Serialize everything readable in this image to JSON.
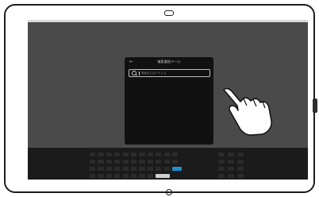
{
  "panel": {
    "back_icon": "←",
    "title": "検索要相ページ"
  },
  "search": {
    "icon": "search-icon",
    "placeholder": "検索またはアドレス"
  },
  "keyboard": {
    "rows": [
      {
        "count": 11,
        "special": "backspace"
      },
      {
        "count": 11
      },
      {
        "count": 11,
        "special": "enter"
      },
      {
        "count": 8,
        "special": "space"
      }
    ],
    "accent_color": "#1f8fd1"
  },
  "gesture": {
    "icon": "pointing-hand-icon"
  }
}
